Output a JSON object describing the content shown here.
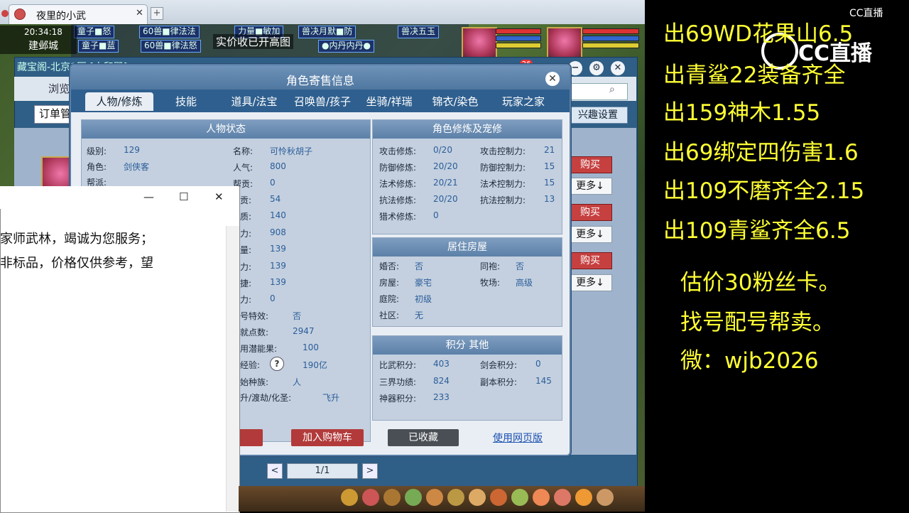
{
  "browser": {
    "tab_title": "夜里的小武",
    "close_glyph": "✕",
    "newtab_glyph": "+"
  },
  "game": {
    "clock": "20:34:18",
    "city": "建邺城",
    "banner": "实价收已开高图",
    "hud_tags": [
      "童子■怒",
      "60兽■律法法",
      "力量■敏加",
      "兽决月默■防",
      "童子■蓝",
      "60兽■律法怒",
      "●内丹内丹●",
      "兽决五玉"
    ]
  },
  "cbg": {
    "title": "藏宝阁-北京1区 [大和殿]",
    "tab_browse": "浏览",
    "order_label": "订单管",
    "interest_button": "兴趣设置",
    "buy_label": "购买",
    "more_label": "更多↓",
    "badge": "26",
    "pager_prev": "<",
    "pager_next": ">",
    "pager_text": "1/1",
    "ctrl_min": "−",
    "ctrl_settings": "⚙",
    "ctrl_close": "✕"
  },
  "dialog": {
    "title": "角色寄售信息",
    "close": "✕",
    "tabs": [
      "人物/修炼",
      "技能",
      "道具/法宝",
      "召唤兽/孩子",
      "坐骑/祥瑞",
      "锦衣/染色",
      "玩家之家"
    ],
    "status_head": "人物状态",
    "status_left": [
      {
        "label": "级别:",
        "value": "129"
      },
      {
        "label": "角色:",
        "value": "剑侠客"
      },
      {
        "label": "帮派:",
        "value": ""
      }
    ],
    "status_right": [
      {
        "label": "名称:",
        "value": "可怜秋胡子"
      },
      {
        "label": "人气:",
        "value": "800"
      },
      {
        "label": "帮贡:",
        "value": "0"
      },
      {
        "label": "贡:",
        "value": "54"
      },
      {
        "label": "质:",
        "value": "140"
      },
      {
        "label": "力:",
        "value": "908"
      },
      {
        "label": "量:",
        "value": "139"
      },
      {
        "label": "力:",
        "value": "139"
      },
      {
        "label": "捷:",
        "value": "139"
      },
      {
        "label": "力:",
        "value": "0"
      },
      {
        "label": "号特效:",
        "value": "否"
      },
      {
        "label": "就点数:",
        "value": "2947"
      },
      {
        "label": "用潜能果:",
        "value": "100"
      },
      {
        "label": "经验:",
        "value": "190亿"
      },
      {
        "label": "始种族:",
        "value": "人"
      },
      {
        "label": "升/渡劫/化圣:",
        "value": "飞升"
      }
    ],
    "cult_head": "角色修炼及宠修",
    "cult_left": [
      {
        "label": "攻击修炼:",
        "value": "0/20"
      },
      {
        "label": "防御修炼:",
        "value": "20/20"
      },
      {
        "label": "法术修炼:",
        "value": "20/21"
      },
      {
        "label": "抗法修炼:",
        "value": "20/20"
      },
      {
        "label": "猎术修炼:",
        "value": "0"
      }
    ],
    "cult_right": [
      {
        "label": "攻击控制力:",
        "value": "21"
      },
      {
        "label": "防御控制力:",
        "value": "15"
      },
      {
        "label": "法术控制力:",
        "value": "15"
      },
      {
        "label": "抗法控制力:",
        "value": "13"
      }
    ],
    "house_head": "居住房屋",
    "house_left": [
      {
        "label": "婚否:",
        "value": "否"
      },
      {
        "label": "房屋:",
        "value": "豪宅"
      },
      {
        "label": "庭院:",
        "value": "初级"
      },
      {
        "label": "社区:",
        "value": "无"
      }
    ],
    "house_right": [
      {
        "label": "同袍:",
        "value": "否"
      },
      {
        "label": "牧场:",
        "value": "高级"
      }
    ],
    "score_head": "积分 其他",
    "score_left": [
      {
        "label": "比武积分:",
        "value": "403"
      },
      {
        "label": "三界功绩:",
        "value": "824"
      },
      {
        "label": "神器积分:",
        "value": "233"
      }
    ],
    "score_right": [
      {
        "label": "剑会积分:",
        "value": "0"
      },
      {
        "label": "副本积分:",
        "value": "145"
      }
    ],
    "help_glyph": "?",
    "btn_cart": "加入购物车",
    "btn_fav": "已收藏",
    "btn_web": "使用网页版"
  },
  "notepad": {
    "line1": "家师武林，竭诚为您服务；",
    "line2": "非标品，价格仅供参考，望",
    "min": "—",
    "max": "☐",
    "close": "✕"
  },
  "right_panel": {
    "cc_top": "CC直播",
    "cc_logo": "CC直播",
    "lines": [
      "出69WD花果山6.5",
      "出青鲨22装备齐全",
      "出159神木1.55",
      "出69绑定四伤害1.6",
      "出109不磨齐全2.15",
      "出109青鲨齐全6.5"
    ],
    "lines2": [
      "估价30粉丝卡。",
      "找号配号帮卖。",
      "微：wjb2026"
    ]
  }
}
